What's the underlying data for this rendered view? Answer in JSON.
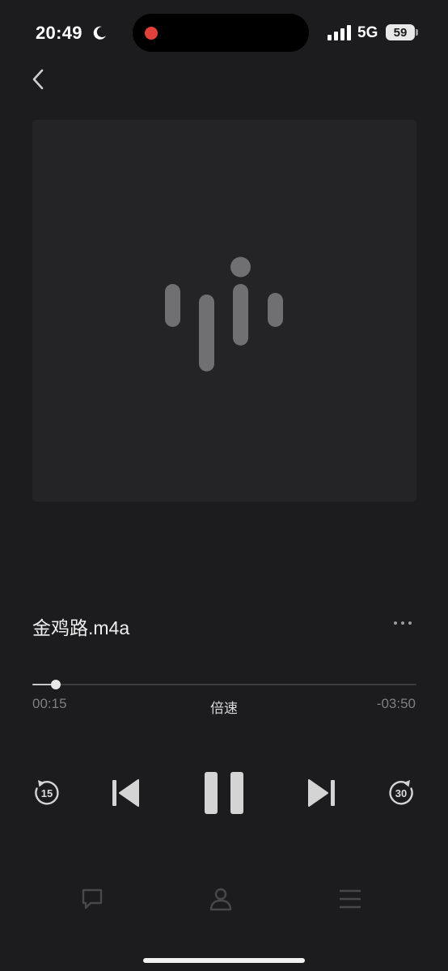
{
  "status_bar": {
    "time": "20:49",
    "network": "5G",
    "battery": "59",
    "icons": [
      "moon-icon",
      "recording-dot",
      "signal-icon",
      "battery-icon"
    ]
  },
  "nav": {
    "back_icon": "chevron-left-icon"
  },
  "artwork": {
    "icon": "audio-waveform-icon"
  },
  "track": {
    "title": "金鸡路.m4a",
    "more_icon": "more-horizontal-icon"
  },
  "progress": {
    "elapsed": "00:15",
    "remaining": "-03:50",
    "fraction": 0.061,
    "speed_label": "倍速"
  },
  "controls": {
    "rewind_seconds": "15",
    "forward_seconds": "30",
    "icons": [
      "rewind-15-icon",
      "skip-previous-icon",
      "pause-icon",
      "skip-next-icon",
      "forward-30-icon"
    ]
  },
  "bottom_tabs": [
    "comment-icon",
    "profile-icon",
    "menu-icon"
  ],
  "colors": {
    "background": "#1c1b1d",
    "artwork": "#242325",
    "accent": "#e0413a",
    "control": "#d4d4d4",
    "muted": "#7f7f82"
  }
}
